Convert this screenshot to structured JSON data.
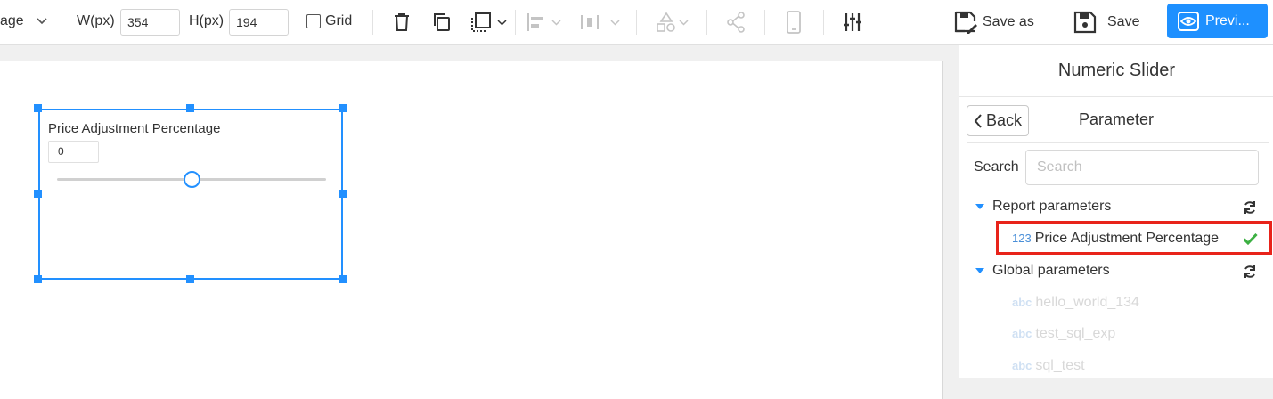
{
  "toolbar": {
    "page_select_label": "age",
    "width_label": "W(px)",
    "width_value": "354",
    "height_label": "H(px)",
    "height_value": "194",
    "grid_label": "Grid",
    "save_as_label": "Save as",
    "save_label": "Save",
    "preview_label": "Previ..."
  },
  "widget": {
    "label": "Price Adjustment Percentage",
    "value": "0",
    "slider_fraction": 0.5
  },
  "panel": {
    "title": "Numeric Slider",
    "back_label": "Back",
    "subtitle": "Parameter",
    "search_label": "Search",
    "search_placeholder": "Search",
    "groups": [
      {
        "label": "Report parameters",
        "items": [
          {
            "type": "123",
            "name": "Price Adjustment Percentage",
            "selected": true
          }
        ]
      },
      {
        "label": "Global parameters",
        "items": [
          {
            "type": "abc",
            "name": "hello_world_134"
          },
          {
            "type": "abc",
            "name": "test_sql_exp"
          },
          {
            "type": "abc",
            "name": "sql_test"
          }
        ]
      }
    ]
  },
  "colors": {
    "accent": "#2290ff",
    "highlight": "#e8231a",
    "check": "#3cb043",
    "disabled": "#c4c4c4"
  }
}
